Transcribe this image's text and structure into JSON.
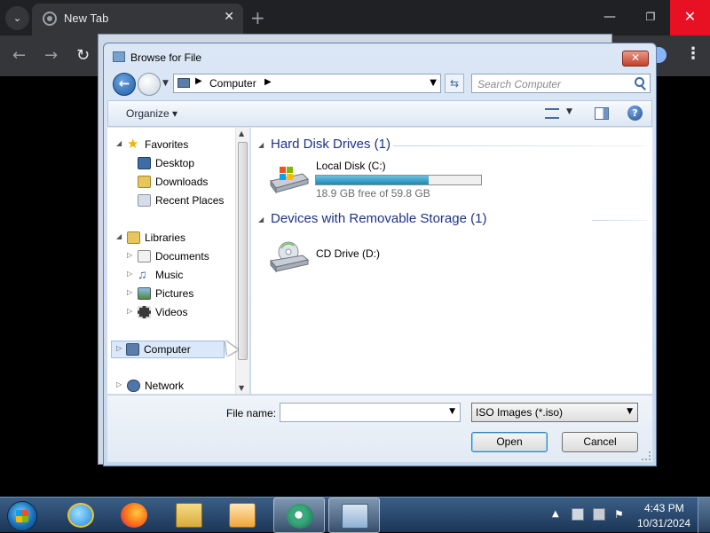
{
  "browser": {
    "tab_title": "New Tab",
    "tab_close": "✕",
    "new_tab": "+",
    "tab_search": "⌄",
    "minimize": "—",
    "maximize": "❐",
    "close": "✕",
    "back": "←",
    "forward": "→",
    "reload": "↻",
    "menu": "⋮"
  },
  "dialog": {
    "title": "Browse for File",
    "close": "✕",
    "back": "←",
    "address": {
      "location": "Computer"
    },
    "search_placeholder": "Search Computer",
    "organize_label": "Organize ▾",
    "help": "?",
    "nav_pane": {
      "favorites": "Favorites",
      "desktop": "Desktop",
      "downloads": "Downloads",
      "recent_places": "Recent Places",
      "libraries": "Libraries",
      "documents": "Documents",
      "music": "Music",
      "pictures": "Pictures",
      "videos": "Videos",
      "computer": "Computer",
      "network": "Network"
    },
    "groups": {
      "hard_disk": {
        "header": "Hard Disk Drives (1)",
        "drive_name": "Local Disk (C:)",
        "free_text": "18.9 GB free of 59.8 GB",
        "used_fraction": 0.684
      },
      "removable": {
        "header": "Devices with Removable Storage (1)",
        "drive_name": "CD Drive (D:)"
      }
    },
    "file_name_label": "File name:",
    "file_name_value": "",
    "file_type": "ISO Images (*.iso)",
    "open_button": "Open",
    "cancel_button": "Cancel"
  },
  "taskbar": {
    "time": "4:43 PM",
    "date": "10/31/2024"
  },
  "colors": {
    "accent": "#1e3287",
    "close_red": "#e81123"
  }
}
